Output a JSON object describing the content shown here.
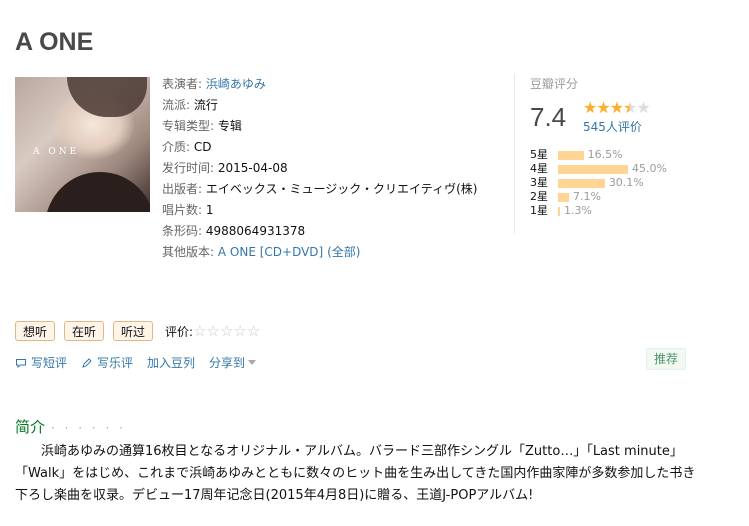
{
  "title": "A ONE",
  "info": {
    "performer_label": "表演者:",
    "performer": "浜崎あゆみ",
    "genre_label": "流派:",
    "genre": "流行",
    "album_type_label": "专辑类型:",
    "album_type": "专辑",
    "medium_label": "介质:",
    "medium": "CD",
    "release_label": "发行时间:",
    "release": "2015-04-08",
    "publisher_label": "出版者:",
    "publisher": "エイベックス・ミュージック・クリエイティヴ(株)",
    "discs_label": "唱片数:",
    "discs": "1",
    "barcode_label": "条形码:",
    "barcode": "4988064931378",
    "other_label": "其他版本:",
    "other_version": "A ONE [CD+DVD]",
    "all_versions": "(全部)"
  },
  "cover": {
    "logo_text": "A ONE"
  },
  "rating": {
    "label": "豆瓣评分",
    "score": "7.4",
    "stars_filled": 3.5,
    "count_text": "545人评价",
    "distribution": [
      {
        "label": "5星",
        "pct": 16.5,
        "pct_text": "16.5%"
      },
      {
        "label": "4星",
        "pct": 45.0,
        "pct_text": "45.0%"
      },
      {
        "label": "3星",
        "pct": 30.1,
        "pct_text": "30.1%"
      },
      {
        "label": "2星",
        "pct": 7.1,
        "pct_text": "7.1%"
      },
      {
        "label": "1星",
        "pct": 1.3,
        "pct_text": "1.3%"
      }
    ],
    "colors": {
      "star": "#ffac2d",
      "bar": "#ffd596"
    }
  },
  "actions": {
    "want": "想听",
    "doing": "在听",
    "done": "听过",
    "rate_label": "评价:",
    "rate_stars": "☆☆☆☆☆"
  },
  "links": {
    "short_review": "写短评",
    "review": "写乐评",
    "add_list": "加入豆列",
    "share": "分享到",
    "recommend": "推荐"
  },
  "intro": {
    "heading": "简介",
    "dots": "· · · · · ·",
    "text": "浜崎あゆみの通算16枚目となるオリジナル・アルバム。バラード三部作シングル「Zutto…」「Last minute」「Walk」をはじめ、これまで浜崎あゆみとともに数々のヒット曲を生み出してきた国内作曲家陣が多数参加した书き下ろし楽曲を収录。デビュー17周年记念日(2015年4月8日)に贈る、王道J-POPアルバム!"
  }
}
